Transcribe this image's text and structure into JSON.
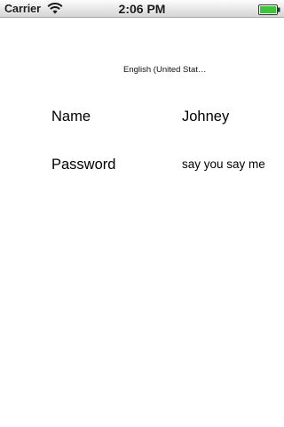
{
  "status_bar": {
    "carrier": "Carrier",
    "time": "2:06 PM",
    "wifi_icon": "wifi-icon",
    "battery_icon": "battery-full-icon",
    "battery_color": "#3cc63c"
  },
  "locale": {
    "label": "English (United Stat…"
  },
  "form": {
    "name_label": "Name",
    "name_value": "Johney",
    "password_label": "Password",
    "password_value": "say you say me"
  }
}
